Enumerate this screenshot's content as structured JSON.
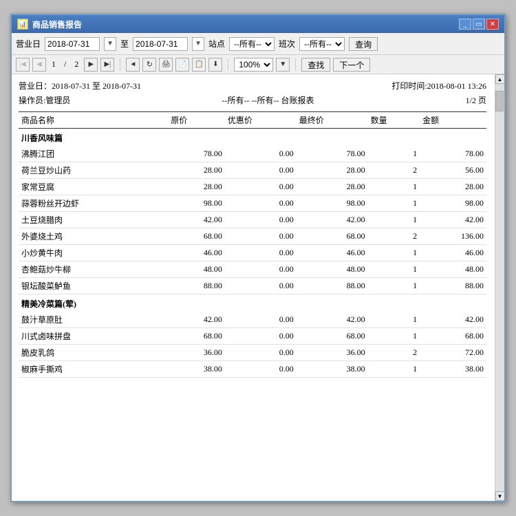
{
  "window": {
    "title": "商品销售报告",
    "icon": "📊"
  },
  "toolbar": {
    "date_label": "营业日",
    "date_from": "2018-07-31",
    "date_to": "2018-07-31",
    "to_label": "至",
    "station_label": "站点",
    "station_value": "--所有--",
    "shift_label": "班次",
    "shift_value": "--所有--",
    "query_btn": "查询"
  },
  "nav": {
    "first": "◀|",
    "prev": "◀",
    "page_current": "1",
    "page_sep": "/",
    "page_total": "2",
    "next": "▶",
    "last": "|▶",
    "back": "◄",
    "refresh_icons": [
      "🔄",
      "🖨",
      "📄",
      "📋",
      "⬇"
    ],
    "zoom": "100%",
    "search_btn": "查找",
    "next_btn": "下一个"
  },
  "report": {
    "date_range_label": "营业日：2018-07-31 至 2018-07-31",
    "print_time_label": "打印时间:2018-08-01 13:26",
    "operator_label": "操作员:管理员",
    "filter_label": "--所有-- --所有-- 台账报表",
    "page_label": "1/2 页",
    "columns": [
      "商品名称",
      "原价",
      "优惠价",
      "最终价",
      "数量",
      "金额"
    ],
    "categories": [
      {
        "name": "川香风味篇",
        "items": [
          {
            "name": "沸腾江团",
            "original": "78.00",
            "discount": "0.00",
            "final": "78.00",
            "qty": "1",
            "amount": "78.00"
          },
          {
            "name": "荷兰豆炒山药",
            "original": "28.00",
            "discount": "0.00",
            "final": "28.00",
            "qty": "2",
            "amount": "56.00"
          },
          {
            "name": "家常豆腐",
            "original": "28.00",
            "discount": "0.00",
            "final": "28.00",
            "qty": "1",
            "amount": "28.00"
          },
          {
            "name": "蒜蓉粉丝开边虾",
            "original": "98.00",
            "discount": "0.00",
            "final": "98.00",
            "qty": "1",
            "amount": "98.00"
          },
          {
            "name": "土豆烧腊肉",
            "original": "42.00",
            "discount": "0.00",
            "final": "42.00",
            "qty": "1",
            "amount": "42.00"
          },
          {
            "name": "外婆烧土鸡",
            "original": "68.00",
            "discount": "0.00",
            "final": "68.00",
            "qty": "2",
            "amount": "136.00"
          },
          {
            "name": "小炒黄牛肉",
            "original": "46.00",
            "discount": "0.00",
            "final": "46.00",
            "qty": "1",
            "amount": "46.00"
          },
          {
            "name": "杏鲍菇炒牛柳",
            "original": "48.00",
            "discount": "0.00",
            "final": "48.00",
            "qty": "1",
            "amount": "48.00"
          },
          {
            "name": "银坛酸菜鲈鱼",
            "original": "88.00",
            "discount": "0.00",
            "final": "88.00",
            "qty": "1",
            "amount": "88.00"
          }
        ]
      },
      {
        "name": "精美冷菜篇(荤)",
        "items": [
          {
            "name": "鼓汁草原肚",
            "original": "42.00",
            "discount": "0.00",
            "final": "42.00",
            "qty": "1",
            "amount": "42.00"
          },
          {
            "name": "川式卤味拼盘",
            "original": "68.00",
            "discount": "0.00",
            "final": "68.00",
            "qty": "1",
            "amount": "68.00"
          },
          {
            "name": "脆皮乳鸽",
            "original": "36.00",
            "discount": "0.00",
            "final": "36.00",
            "qty": "2",
            "amount": "72.00"
          },
          {
            "name": "椒麻手撕鸡",
            "original": "38.00",
            "discount": "0.00",
            "final": "38.00",
            "qty": "1",
            "amount": "38.00"
          }
        ]
      }
    ]
  }
}
